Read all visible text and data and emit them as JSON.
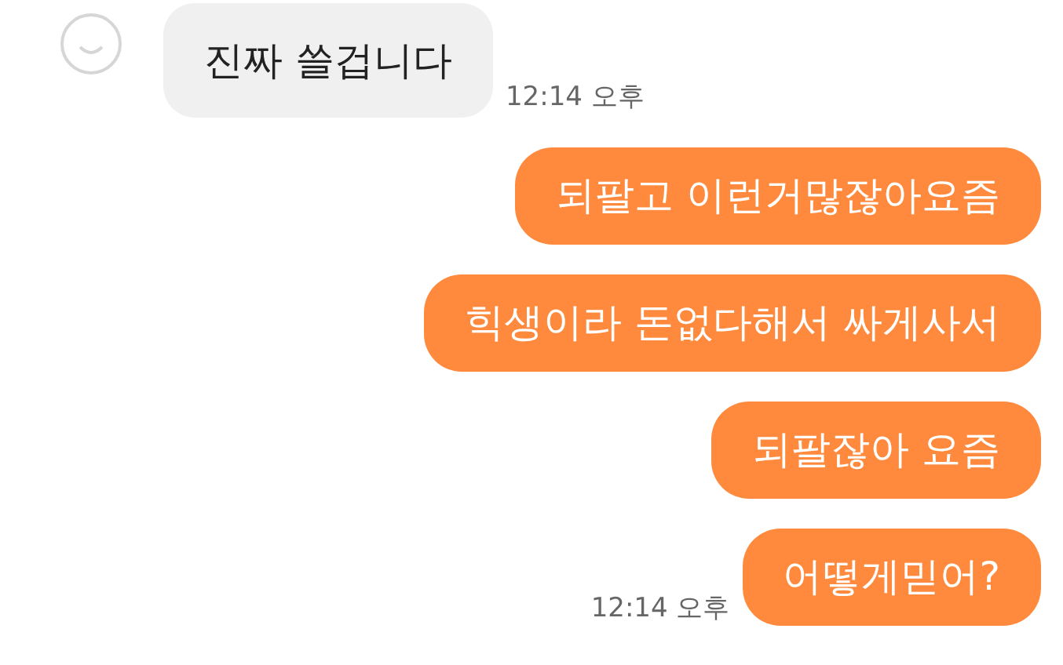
{
  "messages": [
    {
      "kind": "incoming",
      "text": "진짜 쓸겁니다",
      "time": "12:14 오후"
    },
    {
      "kind": "outgoing",
      "text": "되팔고 이런거많잖아요즘"
    },
    {
      "kind": "outgoing",
      "text": "힉생이라 돈없다해서 싸게사서"
    },
    {
      "kind": "outgoing",
      "text": "되팔잖아 요즘"
    },
    {
      "kind": "outgoing",
      "text": "어떻게믿어?",
      "time": "12:14 오후"
    }
  ]
}
